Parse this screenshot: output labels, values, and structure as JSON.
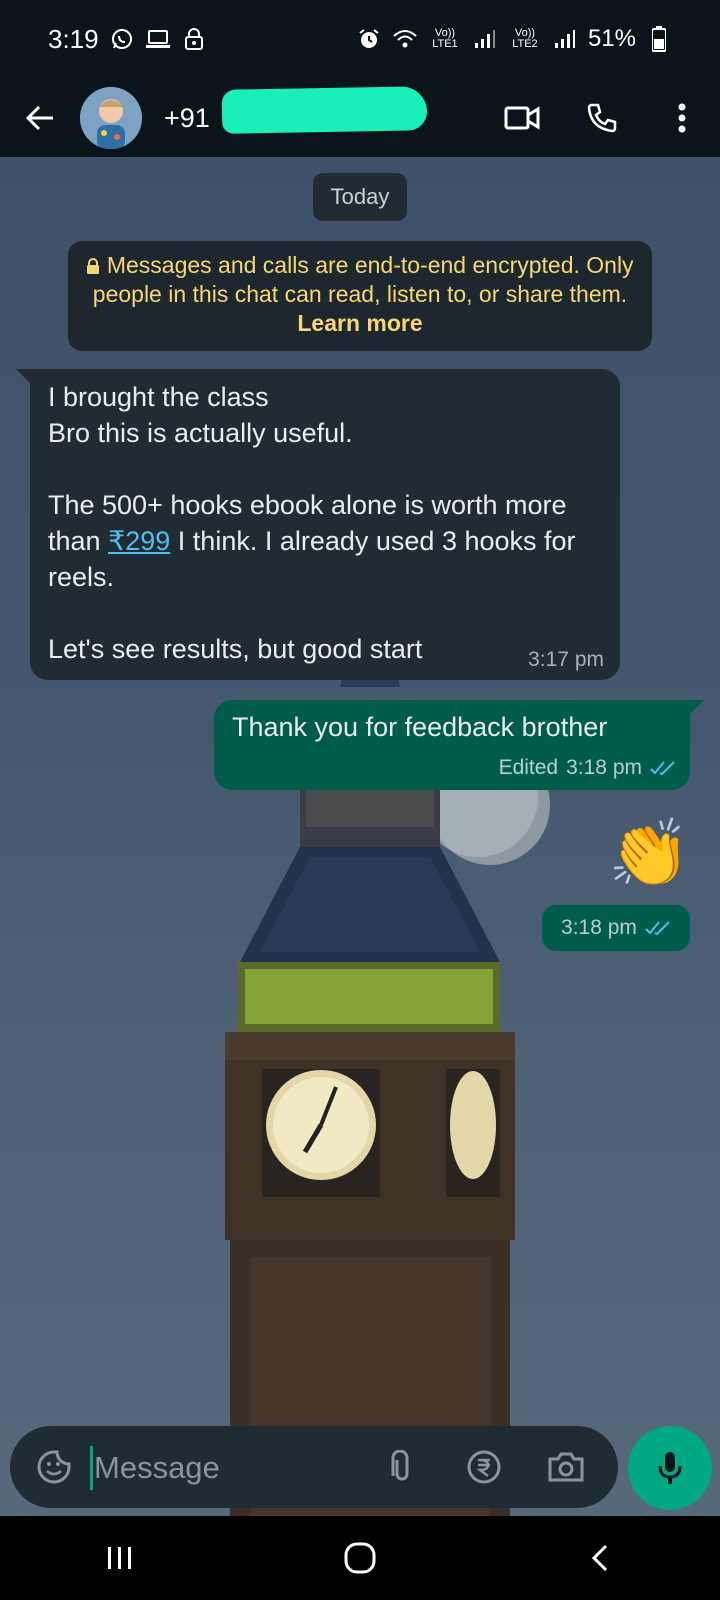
{
  "status_bar": {
    "time": "3:19",
    "sim1": "Vo)) LTE1",
    "sim2": "Vo)) LTE2",
    "battery": "51%"
  },
  "header": {
    "contact": "+91"
  },
  "chat": {
    "date_chip": "Today",
    "encryption_notice": "Messages and calls are end-to-end encrypted. Only people in this chat can read, listen to, or share them.",
    "encryption_link": "Learn more",
    "incoming": {
      "line1": "I brought the class",
      "line2": "Bro this is actually useful.",
      "para2_before": "The 500+ hooks ebook alone is worth more than ",
      "price_link": "₹299",
      "para2_after": " I think. I already used 3 hooks for reels.",
      "para3": "Let's see results, but good start",
      "time": "3:17 pm"
    },
    "outgoing": {
      "text": "Thank you for feedback brother",
      "edited_label": "Edited",
      "time": "3:18 pm"
    },
    "emoji_message": {
      "emoji": "👏",
      "time": "3:18 pm"
    }
  },
  "composer": {
    "placeholder": "Message"
  },
  "colors": {
    "bar": "#0b141a",
    "incoming": "#1f2c34",
    "outgoing": "#005c4b",
    "accent": "#00a884",
    "notice_text": "#f7d774",
    "link": "#53bdeb"
  },
  "icons": [
    "whatsapp-icon",
    "laptop-icon",
    "lock-icon",
    "alarm-icon",
    "wifi-icon",
    "signal-icon",
    "battery-icon",
    "back-arrow-icon",
    "video-call-icon",
    "phone-icon",
    "more-vertical-icon",
    "sticker-icon",
    "attach-icon",
    "rupee-icon",
    "camera-icon",
    "mic-icon",
    "recents-icon",
    "home-icon",
    "nav-back-icon",
    "double-check-icon"
  ]
}
